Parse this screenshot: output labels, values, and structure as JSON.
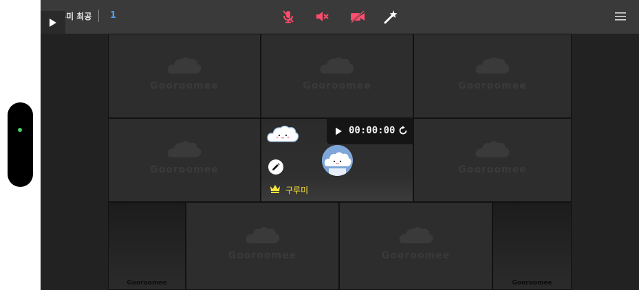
{
  "header": {
    "room_title": "구루미 최공",
    "participant_count": "1"
  },
  "toolbar": {
    "icons": [
      "play-icon",
      "mic-off-icon",
      "speaker-muted-icon",
      "camera-off-icon",
      "magic-wand-icon",
      "menu-icon"
    ],
    "muted_color": "#ff4d6d"
  },
  "grid": {
    "watermark": "Gooroomee",
    "small_watermark": "Gooroomee"
  },
  "my_tile": {
    "timer": "00:00:00",
    "host_name": "구루미",
    "crown_color": "#ffe53b"
  },
  "status": {
    "indicator_color": "#3fd36a"
  }
}
